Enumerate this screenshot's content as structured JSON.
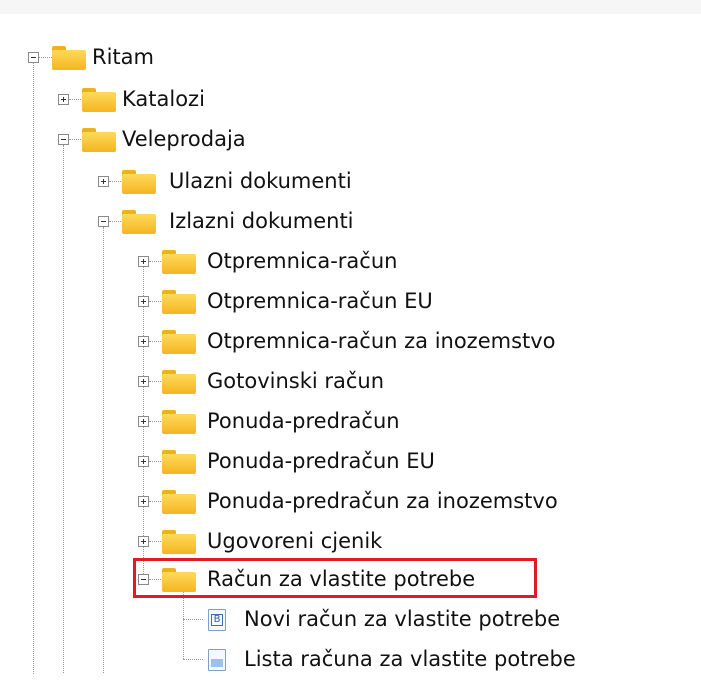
{
  "tree": {
    "root": {
      "label": "Ritam",
      "expanded": true
    },
    "level1": [
      {
        "label": "Katalozi",
        "expanded": false
      },
      {
        "label": "Veleprodaja",
        "expanded": true
      }
    ],
    "level2": [
      {
        "label": "Ulazni dokumenti",
        "expanded": false
      },
      {
        "label": "Izlazni dokumenti",
        "expanded": true
      }
    ],
    "level3": [
      {
        "label": "Otpremnica-račun",
        "expanded": false
      },
      {
        "label": "Otpremnica-račun EU",
        "expanded": false
      },
      {
        "label": "Otpremnica-račun za inozemstvo",
        "expanded": false
      },
      {
        "label": "Gotovinski račun",
        "expanded": false
      },
      {
        "label": "Ponuda-predračun",
        "expanded": false
      },
      {
        "label": "Ponuda-predračun EU",
        "expanded": false
      },
      {
        "label": "Ponuda-predračun za inozemstvo",
        "expanded": false
      },
      {
        "label": "Ugovoreni cjenik",
        "expanded": false
      },
      {
        "label": "Račun za vlastite potrebe",
        "expanded": true,
        "highlighted": true
      }
    ],
    "level4": [
      {
        "label": "Novi račun za vlastite potrebe",
        "icon": "document-b-icon",
        "badge": "B"
      },
      {
        "label": "Lista računa za vlastite potrebe",
        "icon": "document-list-icon"
      }
    ]
  },
  "colors": {
    "highlight_border": "#e01b24",
    "folder": "#f4b521"
  }
}
